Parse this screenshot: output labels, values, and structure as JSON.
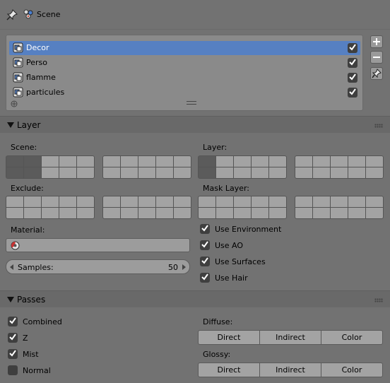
{
  "header": {
    "scene_label": "Scene",
    "icons": [
      "pin-icon",
      "scene-icon"
    ]
  },
  "render_layers": {
    "items": [
      {
        "label": "Decor",
        "selected": true,
        "enabled": true
      },
      {
        "label": "Perso",
        "selected": false,
        "enabled": true
      },
      {
        "label": "flamme",
        "selected": false,
        "enabled": true
      },
      {
        "label": "particules",
        "selected": false,
        "enabled": true
      }
    ],
    "side_buttons": [
      "add-icon",
      "remove-icon",
      "pin-icon"
    ]
  },
  "layer_panel": {
    "title": "Layer",
    "scene_label": "Scene:",
    "layer_label": "Layer:",
    "exclude_label": "Exclude:",
    "mask_layer_label": "Mask Layer:",
    "material_label": "Material:",
    "material_value": "",
    "samples_label": "Samples:",
    "samples_value": "50",
    "options": [
      {
        "label": "Use Environment",
        "checked": true
      },
      {
        "label": "Use AO",
        "checked": true
      },
      {
        "label": "Use Surfaces",
        "checked": true
      },
      {
        "label": "Use Hair",
        "checked": true
      }
    ]
  },
  "passes_panel": {
    "title": "Passes",
    "checks": [
      {
        "label": "Combined",
        "checked": true
      },
      {
        "label": "Z",
        "checked": true
      },
      {
        "label": "Mist",
        "checked": true
      },
      {
        "label": "Normal",
        "checked": false
      }
    ],
    "diffuse_label": "Diffuse:",
    "glossy_label": "Glossy:",
    "segment_labels": [
      "Direct",
      "Indirect",
      "Color"
    ]
  },
  "colors": {
    "background": "#727272",
    "selection": "#5680c2",
    "checkbox": "#3f3f3f"
  }
}
